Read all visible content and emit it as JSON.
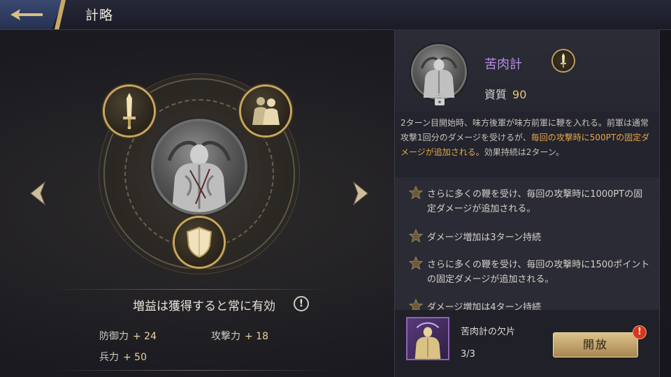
{
  "header": {
    "title": "計略",
    "back_icon": "back-arrow-icon"
  },
  "left": {
    "buff_title": "増益は獲得すると常に有効",
    "stats": [
      {
        "label": "防御力",
        "value": "+ 24"
      },
      {
        "label": "攻撃力",
        "value": "+ 18"
      },
      {
        "label": "兵力",
        "value": "+ 50"
      }
    ],
    "slot_icons": [
      "sword-icon",
      "soldiers-icon",
      "shield-icon"
    ]
  },
  "detail": {
    "name": "苦肉計",
    "quality_label": "資質",
    "quality_value": "90",
    "desc_part1": "2ターン目開始時、味方後軍が味方前軍に鞭を入れる。前軍は通常攻撃1回分のダメージを受けるが、",
    "desc_highlight": "毎回の攻撃時に500PTの固定ダメージが追加される",
    "desc_part2": "。効果持続は2ターン。",
    "effects": [
      "さらに多くの鞭を受け、毎回の攻撃時に1000PTの固定ダメージが追加される。",
      "ダメージ増加は3ターン持続",
      "さらに多くの鞭を受け、毎回の攻撃時に1500ポイントの固定ダメージが追加される。",
      "ダメージ増加は4ターン持続"
    ]
  },
  "fragment": {
    "name": "苦肉計の欠片",
    "count": "3/3",
    "button_label": "開放",
    "alert": "!"
  },
  "colors": {
    "accent_gold": "#c9a764",
    "name_purple": "#b98de6",
    "highlight_orange": "#e7a646"
  }
}
